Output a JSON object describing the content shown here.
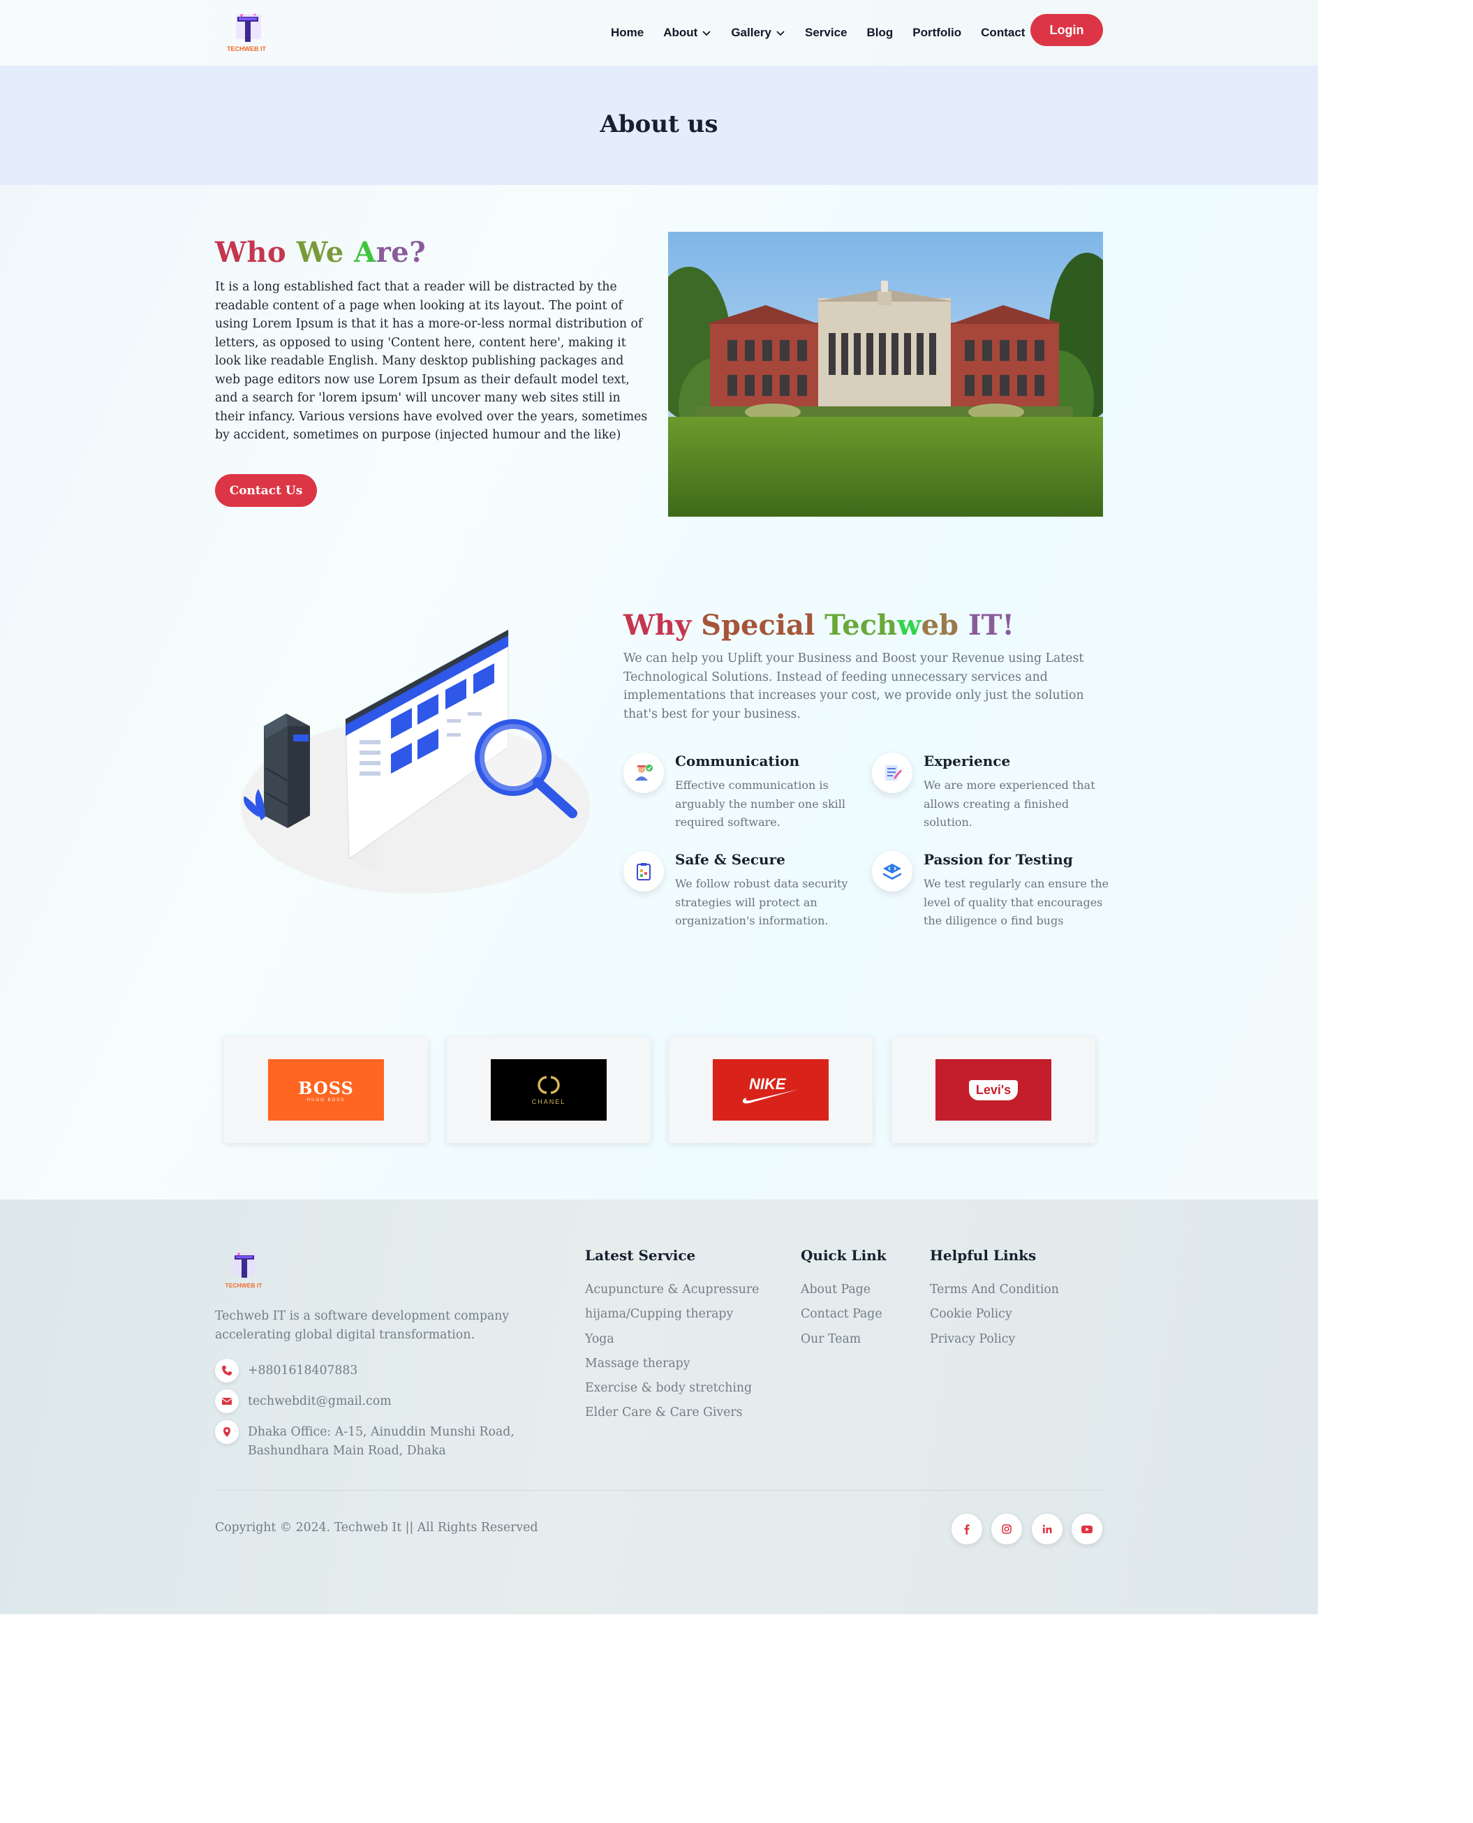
{
  "header": {
    "logo_text": "TECHWEB IT",
    "nav": [
      {
        "label": "Home",
        "dropdown": false
      },
      {
        "label": "About",
        "dropdown": true
      },
      {
        "label": "Gallery",
        "dropdown": true
      },
      {
        "label": "Service",
        "dropdown": false
      },
      {
        "label": "Blog",
        "dropdown": false
      },
      {
        "label": "Portfolio",
        "dropdown": false
      },
      {
        "label": "Contact",
        "dropdown": false
      }
    ],
    "login_label": "Login"
  },
  "banner": {
    "title": "About us"
  },
  "who": {
    "title_parts": [
      "Who ",
      "We ",
      "A",
      "re?"
    ],
    "text": "It is a long established fact that a reader will be distracted by the readable content of a page when looking at its layout. The point of using Lorem Ipsum is that it has a more-or-less normal distribution of letters, as opposed to using 'Content here, content here', making it look like readable English. Many desktop publishing packages and web page editors now use Lorem Ipsum as their default model text, and a search for 'lorem ipsum' will uncover many web sites still in their infancy. Various versions have evolved over the years, sometimes by accident, sometimes on purpose (injected humour and the like)",
    "button_label": "Contact Us"
  },
  "why": {
    "title_parts": [
      "Why ",
      "Special ",
      "Tech",
      "w",
      "eb ",
      "IT!"
    ],
    "description": "We can help you Uplift your Business and Boost your Revenue using Latest Technological Solutions. Instead of feeding unnecessary services and implementations that increases your cost, we provide only just the solution that's best for your business.",
    "features": [
      {
        "title": "Communication",
        "text": "Effective communication is arguably the number one skill required software.",
        "icon": "communication-icon"
      },
      {
        "title": "Experience",
        "text": "We are more experienced that allows creating a finished solution.",
        "icon": "experience-icon"
      },
      {
        "title": "Safe & Secure",
        "text": "We follow robust data security strategies will protect an organization's information.",
        "icon": "clipboard-secure-icon"
      },
      {
        "title": "Passion for Testing",
        "text": "We test regularly can ensure the level of quality that encourages the diligence o find bugs",
        "icon": "layers-code-icon"
      }
    ]
  },
  "brands": [
    {
      "name": "BOSS",
      "sub": "HUGO BOSS",
      "bg": "#ff6622"
    },
    {
      "name": "CHANEL",
      "bg": "#000000"
    },
    {
      "name": "NIKE",
      "bg": "#d9231a"
    },
    {
      "name": "Levi's",
      "bg": "#c41e2c"
    }
  ],
  "footer": {
    "logo_text": "TECHWEB IT",
    "about": "Techweb IT is a software development company accelerating global digital transformation.",
    "phone": "+8801618407883",
    "email": "techwebdit@gmail.com",
    "address": "Dhaka Office: A-15, Ainuddin Munshi Road, Bashundhara Main Road, Dhaka",
    "latest_service": {
      "title": "Latest Service",
      "items": [
        "Acupuncture & Acupressure",
        "hijama/Cupping therapy",
        "Yoga",
        "Massage therapy",
        "Exercise & body stretching",
        "Elder Care & Care Givers"
      ]
    },
    "quick_link": {
      "title": "Quick Link",
      "items": [
        "About Page",
        "Contact Page",
        "Our Team"
      ]
    },
    "helpful_links": {
      "title": "Helpful Links",
      "items": [
        "Terms And Condition",
        "Cookie Policy",
        "Privacy Policy"
      ]
    },
    "copyright": "Copyright © 2024. Techweb It || All Rights Reserved",
    "social": [
      "facebook-icon",
      "instagram-icon",
      "linkedin-icon",
      "youtube-icon"
    ]
  },
  "colors": {
    "accent": "#dc3545",
    "banner_bg": "#e4edfb",
    "heading": "#16202e",
    "muted_text": "#737c86"
  }
}
